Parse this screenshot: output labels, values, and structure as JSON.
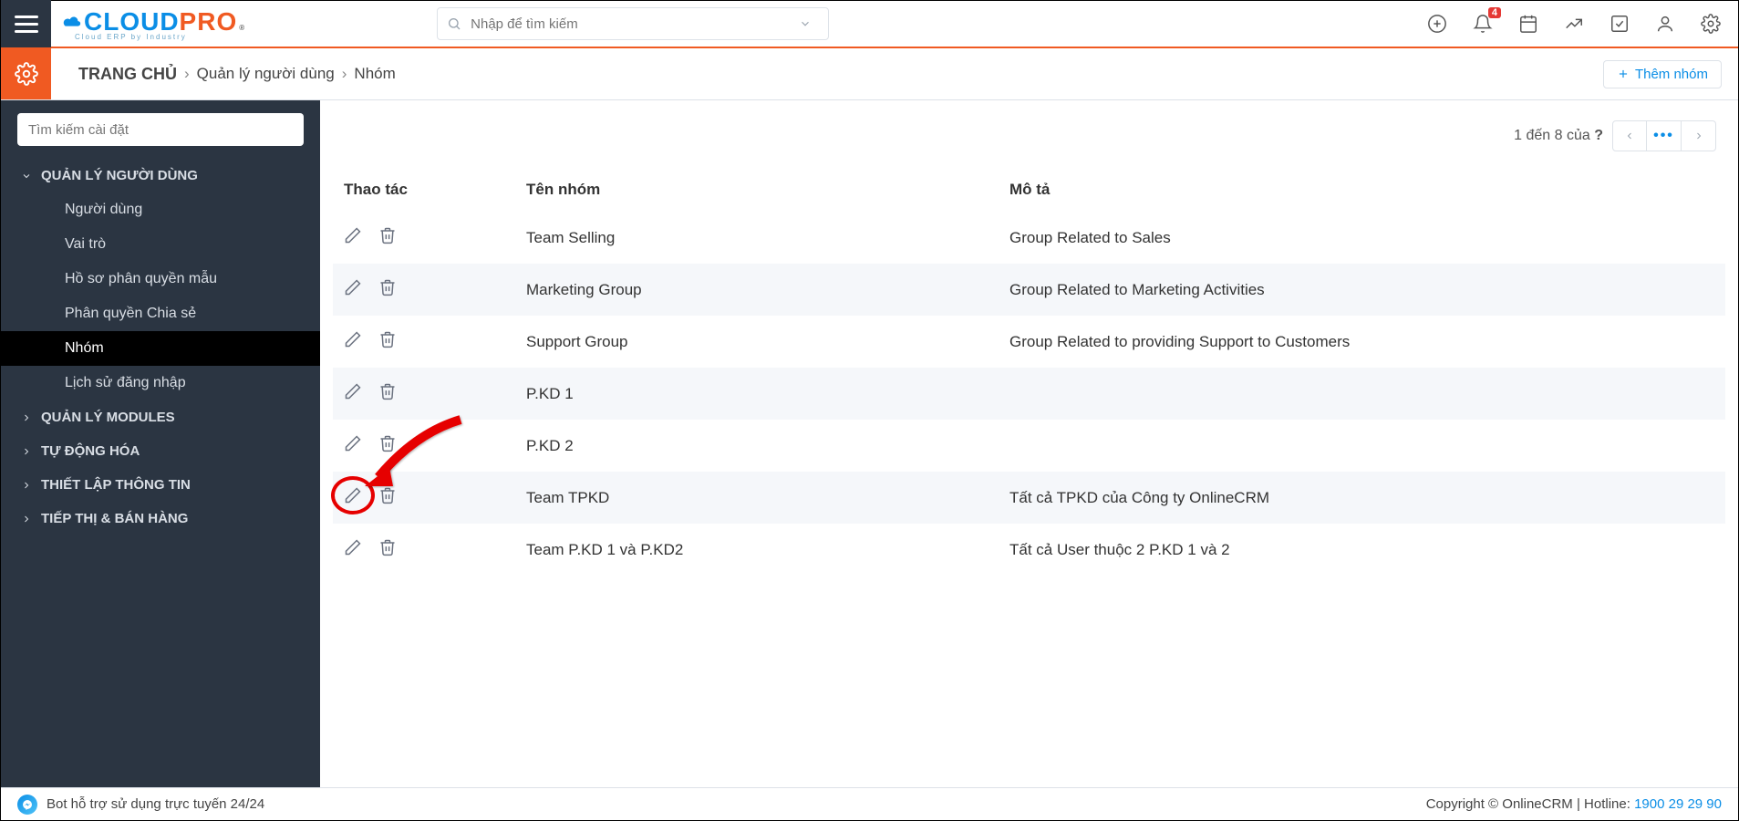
{
  "logo": {
    "cloud": "CLOUD",
    "pro": "PRO",
    "sup": "®",
    "sub": "Cloud ERP by Industry"
  },
  "search": {
    "placeholder": "Nhập để tìm kiếm"
  },
  "notifications_count": "4",
  "breadcrumbs": {
    "home": "TRANG CHỦ",
    "level1": "Quản lý người dùng",
    "level2": "Nhóm"
  },
  "add_group_label": "Thêm nhóm",
  "sidebar_filter_placeholder": "Tìm kiếm cài đặt",
  "sidebar": {
    "group_open": "QUẢN LÝ NGƯỜI DÙNG",
    "subs": [
      "Người dùng",
      "Vai trò",
      "Hồ sơ phân quyền mẫu",
      "Phân quyền Chia sẻ",
      "Nhóm",
      "Lịch sử đăng nhập"
    ],
    "groups_closed": [
      "QUẢN LÝ MODULES",
      "TỰ ĐỘNG HÓA",
      "THIẾT LẬP THÔNG TIN",
      "TIẾP THỊ & BÁN HÀNG"
    ]
  },
  "pager": {
    "text_prefix": "1 đến 8 của ",
    "unknown": "?"
  },
  "columns": {
    "action": "Thao tác",
    "name": "Tên nhóm",
    "desc": "Mô tả"
  },
  "rows": [
    {
      "name": "Team Selling",
      "desc": "Group Related to Sales"
    },
    {
      "name": "Marketing Group",
      "desc": "Group Related to Marketing Activities"
    },
    {
      "name": "Support Group",
      "desc": "Group Related to providing Support to Customers"
    },
    {
      "name": "P.KD 1",
      "desc": ""
    },
    {
      "name": "P.KD 2",
      "desc": ""
    },
    {
      "name": "Team TPKD",
      "desc": "Tất cả TPKD của Công ty OnlineCRM"
    },
    {
      "name": "Team P.KD 1 và P.KD2",
      "desc": "Tất cả User thuộc 2 P.KD 1 và 2"
    }
  ],
  "footer": {
    "bot": "Bot hỗ trợ sử dụng trực tuyến 24/24",
    "copyright": "Copyright © OnlineCRM",
    "hotline_label": " | Hotline: ",
    "hotline": "1900 29 29 90"
  },
  "annotation": {
    "target_row_index": 5
  }
}
